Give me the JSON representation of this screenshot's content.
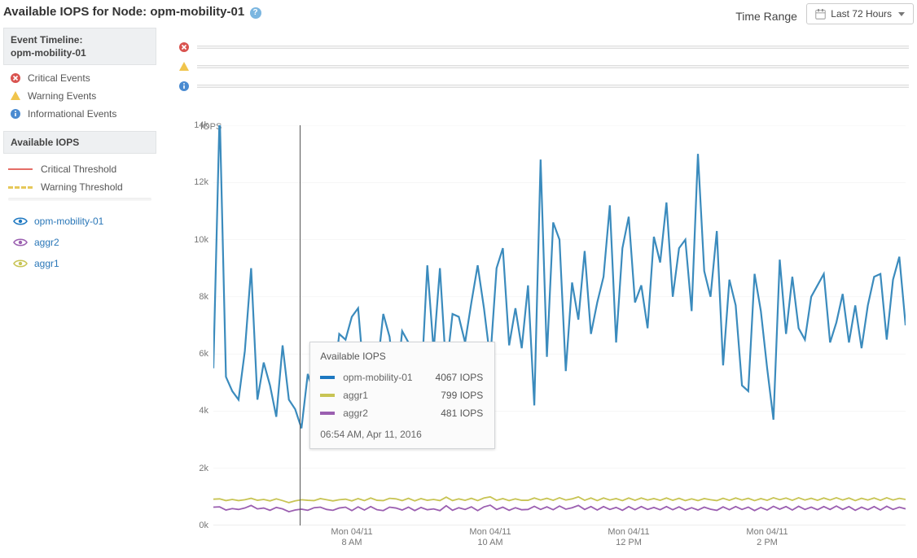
{
  "title_prefix": "Available IOPS for Node: ",
  "title_node": "opm-mobility-01",
  "time_range": {
    "label": "Time Range",
    "button": "Last 72 Hours"
  },
  "sidebar": {
    "timeline_head_l1": "Event Timeline:",
    "timeline_head_l2": "opm-mobility-01",
    "events": {
      "critical": "Critical Events",
      "warning": "Warning Events",
      "info": "Informational Events"
    },
    "iops_head": "Available IOPS",
    "thresholds": {
      "critical": "Critical Threshold",
      "warning": "Warning Threshold"
    },
    "series": [
      {
        "name": "opm-mobility-01",
        "color": "#1d78c1"
      },
      {
        "name": "aggr2",
        "color": "#9b5fb0"
      },
      {
        "name": "aggr1",
        "color": "#c8c454"
      }
    ]
  },
  "tooltip": {
    "title": "Available IOPS",
    "rows": [
      {
        "name": "opm-mobility-01",
        "value": "4067 IOPS",
        "color": "#1d78c1"
      },
      {
        "name": "aggr1",
        "value": "799 IOPS",
        "color": "#c8c454"
      },
      {
        "name": "aggr2",
        "value": "481 IOPS",
        "color": "#9b5fb0"
      }
    ],
    "time": "06:54 AM, Apr 11, 2016"
  },
  "chart_data": {
    "type": "line",
    "title": "Available IOPS for Node: opm-mobility-01",
    "xlabel": "",
    "ylabel": "IOPS",
    "ylim": [
      0,
      14000
    ],
    "y_ticks": [
      0,
      2000,
      4000,
      6000,
      8000,
      10000,
      12000,
      14000
    ],
    "y_tick_labels": [
      "0k",
      "2k",
      "4k",
      "6k",
      "8k",
      "10k",
      "12k",
      "14k"
    ],
    "x_tick_labels": [
      {
        "pos": 0.2,
        "l1": "Mon 04/11",
        "l2": "8 AM"
      },
      {
        "pos": 0.4,
        "l1": "Mon 04/11",
        "l2": "10 AM"
      },
      {
        "pos": 0.6,
        "l1": "Mon 04/11",
        "l2": "12 PM"
      },
      {
        "pos": 0.8,
        "l1": "Mon 04/11",
        "l2": "2 PM"
      }
    ],
    "cursor_x": 0.125,
    "series": [
      {
        "name": "opm-mobility-01",
        "color": "#3b8bbd",
        "values": [
          5500,
          14500,
          5200,
          4700,
          4400,
          6100,
          9000,
          4400,
          5700,
          4900,
          3800,
          6300,
          4400,
          4067,
          3400,
          5300,
          4600,
          5200,
          4000,
          4700,
          6700,
          6500,
          7300,
          7600,
          5000,
          5700,
          5400,
          7400,
          6600,
          4600,
          6800,
          6400,
          4400,
          4800,
          9100,
          6100,
          9000,
          5400,
          7400,
          7300,
          6400,
          7800,
          9100,
          7600,
          5800,
          9000,
          9700,
          6300,
          7600,
          6200,
          8400,
          4200,
          12800,
          5900,
          10600,
          10000,
          5400,
          8500,
          7200,
          9600,
          6700,
          7800,
          8700,
          11200,
          6400,
          9700,
          10800,
          7800,
          8400,
          6900,
          10100,
          9200,
          11300,
          8000,
          9700,
          10000,
          7500,
          13000,
          8900,
          8000,
          10300,
          5600,
          8600,
          7700,
          4900,
          4700,
          8800,
          7500,
          5500,
          3700,
          9300,
          6700,
          8700,
          6900,
          6500,
          8000,
          8400,
          8800,
          6400,
          7100,
          8100,
          6400,
          7700,
          6200,
          7700,
          8700,
          8800,
          6500,
          8600,
          9400,
          7000
        ]
      },
      {
        "name": "aggr1",
        "color": "#c8c454",
        "values": [
          920,
          930,
          870,
          910,
          870,
          900,
          950,
          880,
          910,
          860,
          930,
          870,
          799,
          860,
          900,
          880,
          870,
          940,
          900,
          860,
          900,
          920,
          860,
          940,
          870,
          960,
          880,
          870,
          950,
          930,
          870,
          950,
          860,
          940,
          880,
          910,
          870,
          990,
          870,
          930,
          880,
          950,
          870,
          960,
          1000,
          880,
          940,
          870,
          930,
          880,
          880,
          960,
          890,
          950,
          880,
          970,
          890,
          930,
          1000,
          880,
          960,
          870,
          960,
          890,
          940,
          870,
          960,
          880,
          960,
          890,
          940,
          880,
          960,
          880,
          950,
          870,
          930,
          870,
          940,
          900,
          870,
          950,
          880,
          960,
          890,
          950,
          870,
          940,
          880,
          970,
          900,
          960,
          880,
          970,
          890,
          950,
          880,
          960,
          890,
          970,
          890,
          960,
          870,
          950,
          890,
          960,
          880,
          970,
          890,
          950,
          910
        ]
      },
      {
        "name": "aggr2",
        "color": "#9b5fb0",
        "values": [
          640,
          650,
          540,
          590,
          560,
          610,
          700,
          580,
          610,
          530,
          630,
          580,
          481,
          540,
          570,
          530,
          620,
          640,
          560,
          530,
          610,
          640,
          520,
          650,
          540,
          660,
          550,
          520,
          640,
          610,
          540,
          640,
          520,
          630,
          550,
          580,
          520,
          690,
          530,
          620,
          560,
          650,
          520,
          650,
          710,
          560,
          640,
          530,
          620,
          550,
          560,
          670,
          560,
          650,
          550,
          680,
          570,
          620,
          700,
          560,
          660,
          540,
          660,
          560,
          630,
          530,
          660,
          550,
          660,
          560,
          630,
          550,
          660,
          550,
          650,
          540,
          620,
          540,
          640,
          570,
          530,
          650,
          550,
          660,
          560,
          640,
          520,
          630,
          540,
          670,
          570,
          660,
          540,
          670,
          560,
          640,
          550,
          660,
          560,
          680,
          560,
          660,
          530,
          640,
          550,
          660,
          540,
          670,
          560,
          640,
          580
        ]
      }
    ]
  }
}
